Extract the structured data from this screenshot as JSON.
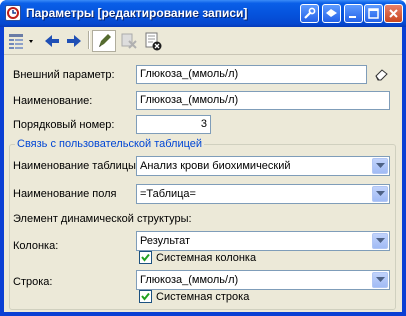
{
  "window": {
    "title": "Параметры [редактирование записи]"
  },
  "title_buttons": [
    "wrench-icon",
    "layers-icon",
    "minimize-icon",
    "maximize-icon",
    "close-icon"
  ],
  "toolbar": {
    "items": [
      "list-menu-icon",
      "arrow-left-icon",
      "arrow-right-icon",
      "save-pen-icon",
      "delete-icon",
      "document-close-icon"
    ]
  },
  "form": {
    "external_param": {
      "label": "Внешний параметр:",
      "value": "Глюкоза_(ммоль/л)"
    },
    "name": {
      "label": "Наименование:",
      "value": "Глюкоза_(ммоль/л)"
    },
    "order": {
      "label": "Порядковый номер:",
      "value": "3"
    }
  },
  "link_group": {
    "title": "Связь с пользовательской таблицей",
    "table_name": {
      "label": "Наименование таблицы",
      "value": "Анализ крови биохимический"
    },
    "field_name": {
      "label": "Наименование поля",
      "value": "=Таблица="
    },
    "dynamic_title": "Элемент динамической структуры:",
    "column": {
      "label": "Колонка:",
      "value": "Результат",
      "checkbox_label": "Системная колонка",
      "checked": true
    },
    "row": {
      "label": "Строка:",
      "value": "Глюкоза_(ммоль/л)",
      "checkbox_label": "Системная строка",
      "checked": true
    }
  },
  "colors": {
    "titlebar": "#0553dd",
    "face": "#ece9d8",
    "field_border": "#7f9db9",
    "group_title": "#0046d5"
  }
}
